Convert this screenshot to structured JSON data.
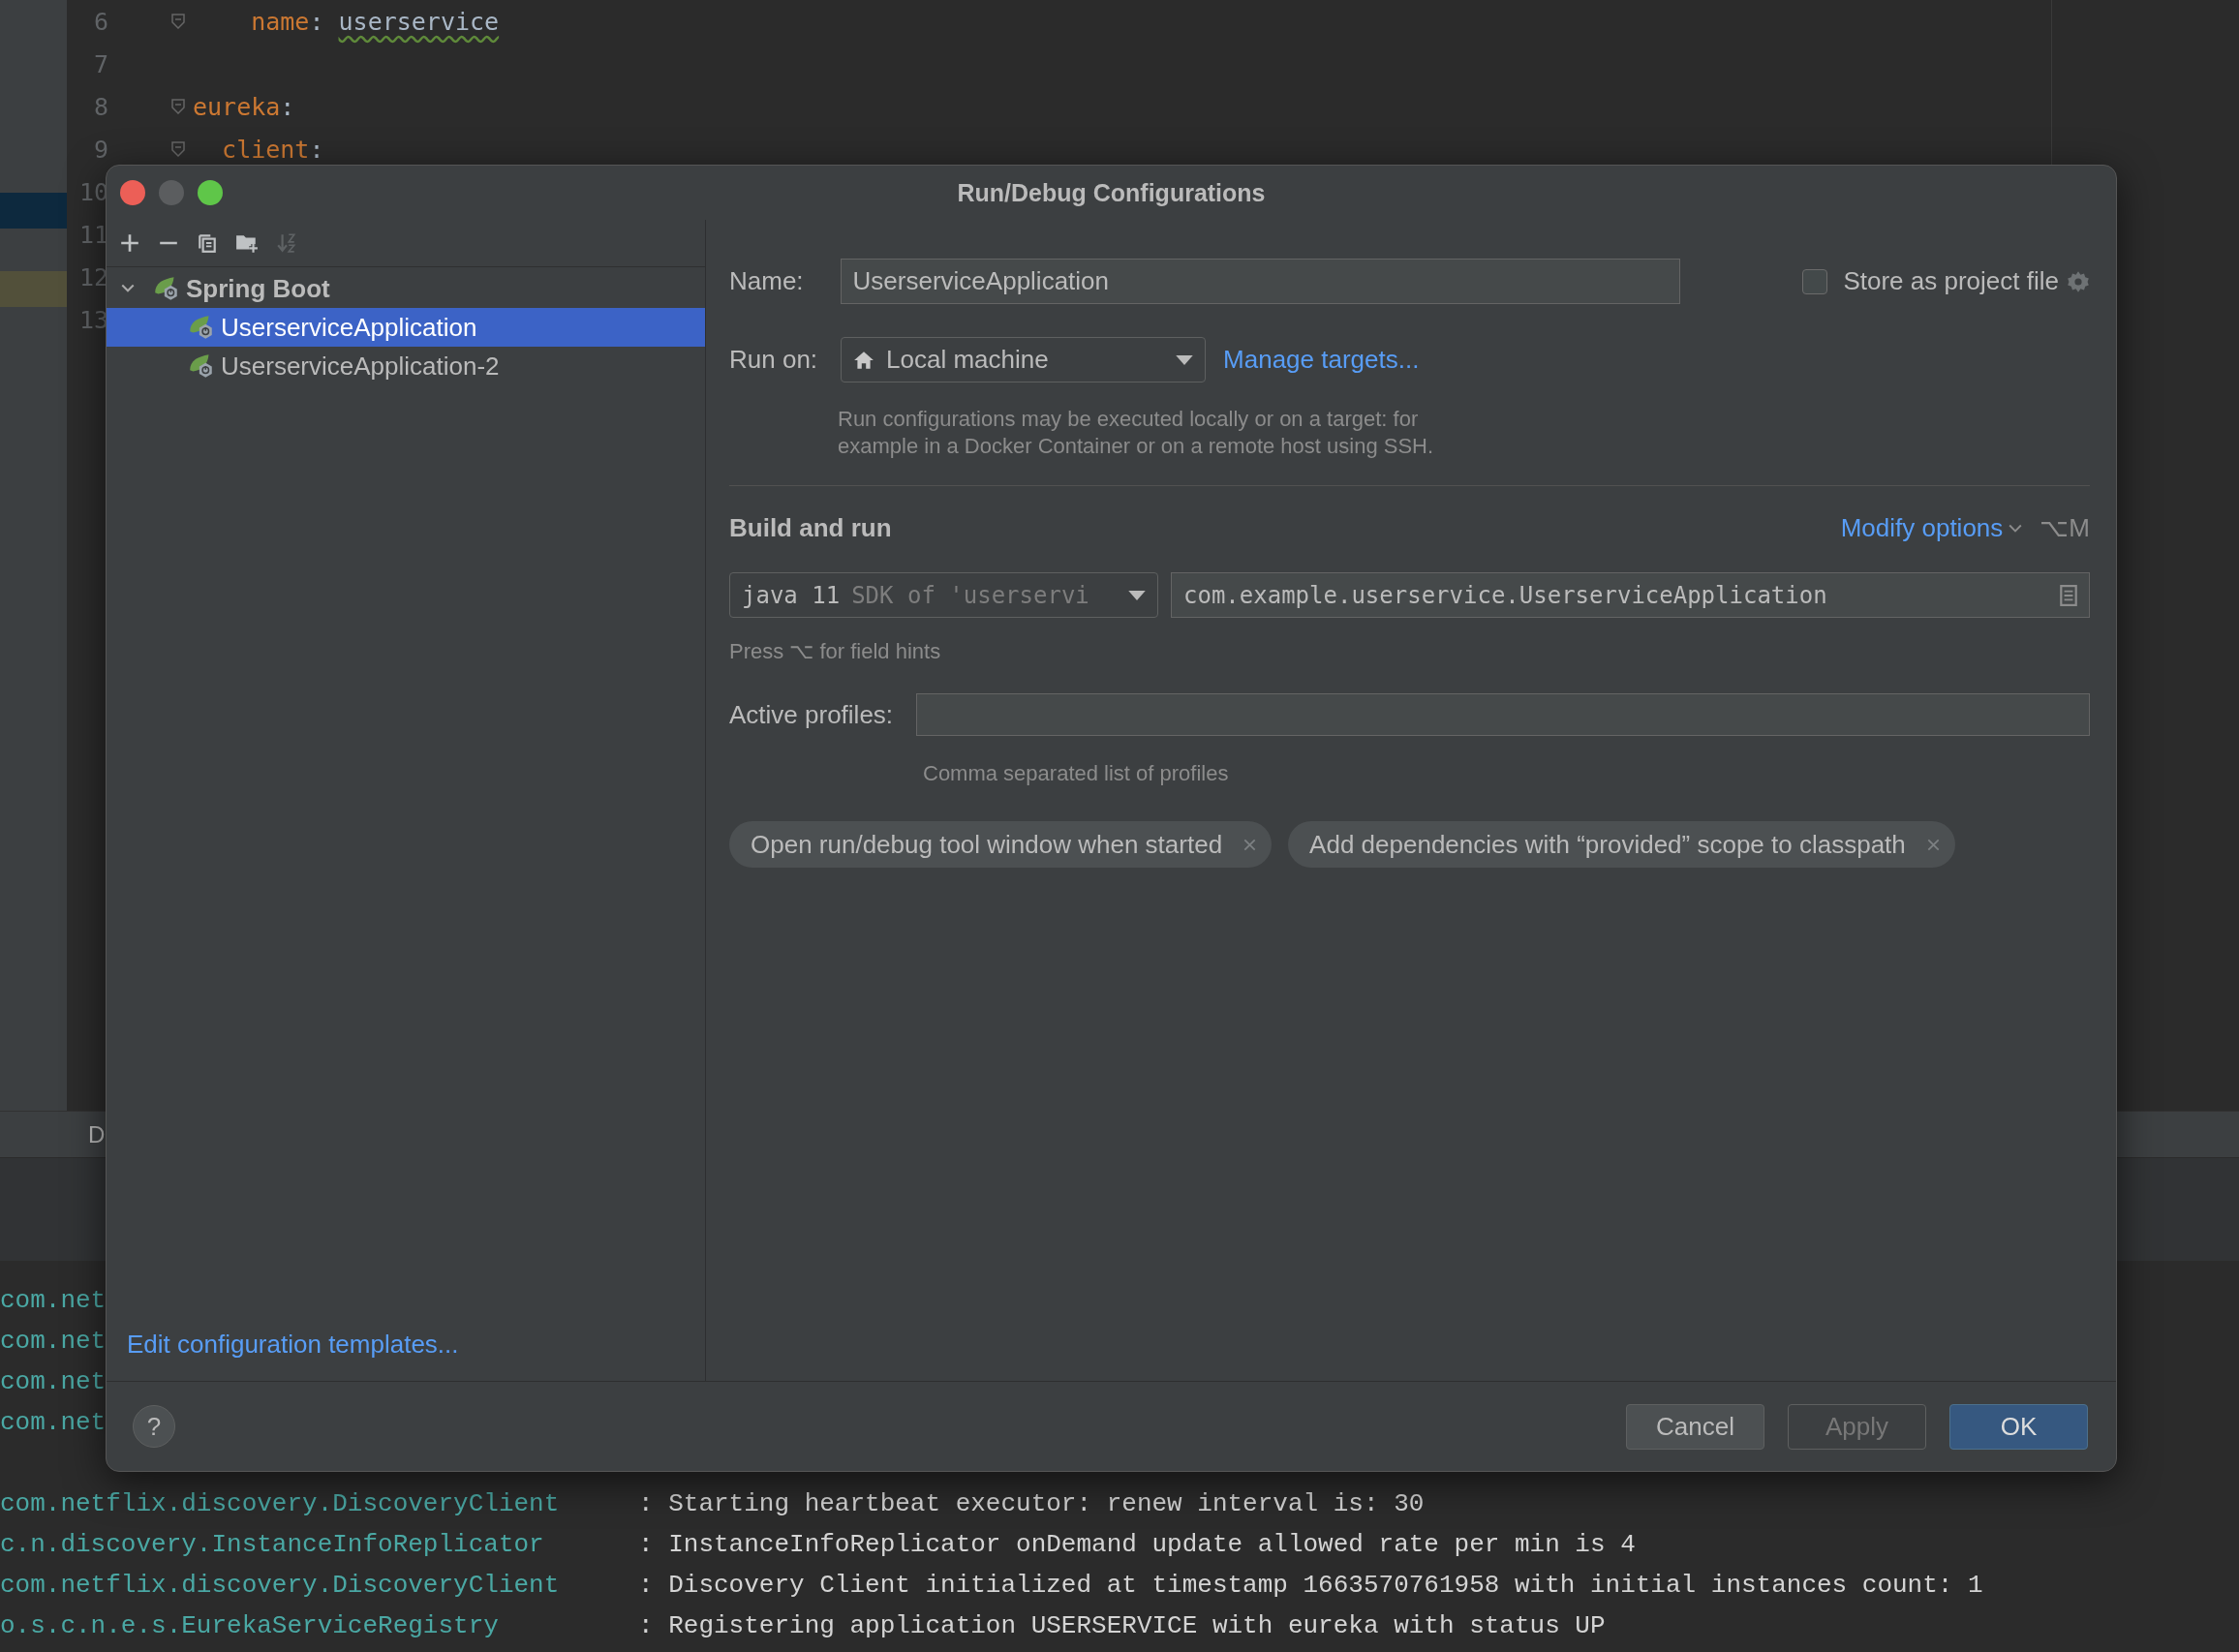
{
  "editor": {
    "lines": [
      {
        "number": "6",
        "fold": true,
        "tokens": [
          {
            "kind": "key",
            "text": "    name"
          },
          {
            "kind": "plain",
            "text": ": "
          },
          {
            "kind": "value",
            "text": "userservice",
            "typo": true
          }
        ]
      },
      {
        "number": "7",
        "fold": false
      },
      {
        "number": "8",
        "fold": true,
        "tokens": [
          {
            "kind": "key",
            "text": "eureka",
            "typo": false
          },
          {
            "kind": "plain",
            "text": ":"
          }
        ]
      },
      {
        "number": "9",
        "fold": true,
        "tokens": [
          {
            "kind": "key",
            "text": "  client"
          },
          {
            "kind": "plain",
            "text": ":"
          }
        ]
      },
      {
        "number": "10"
      },
      {
        "number": "11"
      },
      {
        "number": "12"
      },
      {
        "number": "13"
      }
    ]
  },
  "tool_window": {
    "label": "D"
  },
  "console": {
    "rows": [
      {
        "source": "com.net"
      },
      {
        "source": "com.net"
      },
      {
        "source": "com.net"
      },
      {
        "source": "com.net"
      },
      {
        "source": "com.netflix.discovery.DiscoveryClient",
        "message": ": Starting heartbeat executor: renew interval is: 30"
      },
      {
        "source": "c.n.discovery.InstanceInfoReplicator",
        "message": ": InstanceInfoReplicator onDemand update allowed rate per min is 4"
      },
      {
        "source": "com.netflix.discovery.DiscoveryClient",
        "message": ": Discovery Client initialized at timestamp 1663570761958 with initial instances count: 1"
      },
      {
        "source": "o.s.c.n.e.s.EurekaServiceRegistry",
        "message": ": Registering application USERSERVICE with eureka with status UP"
      }
    ]
  },
  "dialog": {
    "title": "Run/Debug Configurations",
    "toolbar": [
      {
        "kind": "add",
        "disabled": false
      },
      {
        "kind": "remove",
        "disabled": false
      },
      {
        "kind": "copy",
        "disabled": false
      },
      {
        "kind": "folder",
        "disabled": false
      },
      {
        "kind": "sort",
        "disabled": true
      }
    ],
    "tree": [
      {
        "label": "Spring Boot",
        "expanded": true,
        "selected": false,
        "children": [
          {
            "label": "UserserviceApplication",
            "selected": true
          },
          {
            "label": "UserserviceApplication-2",
            "selected": false
          }
        ]
      }
    ],
    "templates_link": "Edit configuration templates...",
    "form": {
      "name_label": "Name:",
      "name_value": "UserserviceApplication",
      "store_checkbox": {
        "label": "Store as project file",
        "checked": false
      },
      "run_on_label": "Run on:",
      "run_on_value": "Local machine",
      "manage_link": "Manage targets...",
      "run_on_hint": "Run configurations may be executed locally or on a target: for\nexample in a Docker Container or on a remote host using SSH.",
      "section_title": "Build and run",
      "modify_link": "Modify options",
      "modify_shortcut": "⌥M",
      "sdk": {
        "value": "java 11",
        "hint": "SDK of 'userservi"
      },
      "main_class": "com.example.userservice.UserserviceApplication",
      "field_hint": "Press ⌥ for field hints",
      "profiles_label": "Active profiles:",
      "profiles_hint": "Comma separated list of profiles",
      "chips": [
        "Open run/debug tool window when started",
        "Add dependencies with “provided” scope to classpath"
      ]
    },
    "help": "?",
    "buttons": [
      {
        "label": "Cancel",
        "kind": "normal",
        "disabled": false
      },
      {
        "label": "Apply",
        "kind": "normal",
        "disabled": true
      },
      {
        "label": "OK",
        "kind": "default",
        "disabled": false
      }
    ]
  }
}
